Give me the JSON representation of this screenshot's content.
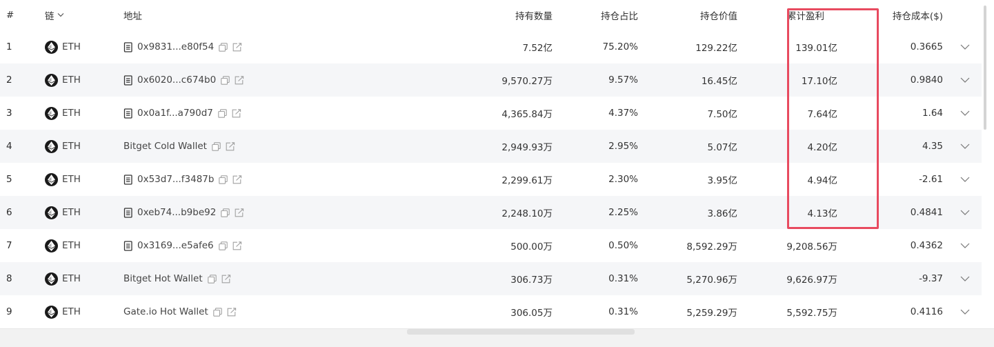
{
  "columns": {
    "index": "#",
    "chain": "链",
    "address": "地址",
    "holdings": "持有数量",
    "share": "持仓占比",
    "value": "持仓价值",
    "cumulative_pnl": "累计盈利",
    "cost_basis": "持仓成本($)"
  },
  "icons": {
    "chain_logo": "ethereum-icon",
    "contract": "document-icon",
    "copy": "copy-icon",
    "link": "external-link-icon",
    "expand": "chevron-down-icon"
  },
  "colors": {
    "highlight_border": "#e84a5f",
    "row_alt_bg": "#f5f6f8"
  },
  "rows": [
    {
      "index": "1",
      "chain": "ETH",
      "address": "0x9831...e80f54",
      "is_contract": true,
      "holdings": "7.52亿",
      "share": "75.20%",
      "value": "129.22亿",
      "pnl": "139.01亿",
      "cost": "0.3665"
    },
    {
      "index": "2",
      "chain": "ETH",
      "address": "0x6020...c674b0",
      "is_contract": true,
      "holdings": "9,570.27万",
      "share": "9.57%",
      "value": "16.45亿",
      "pnl": "17.10亿",
      "cost": "0.9840"
    },
    {
      "index": "3",
      "chain": "ETH",
      "address": "0x0a1f...a790d7",
      "is_contract": true,
      "holdings": "4,365.84万",
      "share": "4.37%",
      "value": "7.50亿",
      "pnl": "7.64亿",
      "cost": "1.64"
    },
    {
      "index": "4",
      "chain": "ETH",
      "address": "Bitget Cold Wallet",
      "is_contract": false,
      "holdings": "2,949.93万",
      "share": "2.95%",
      "value": "5.07亿",
      "pnl": "4.20亿",
      "cost": "4.35"
    },
    {
      "index": "5",
      "chain": "ETH",
      "address": "0x53d7...f3487b",
      "is_contract": true,
      "holdings": "2,299.61万",
      "share": "2.30%",
      "value": "3.95亿",
      "pnl": "4.94亿",
      "cost": "-2.61"
    },
    {
      "index": "6",
      "chain": "ETH",
      "address": "0xeb74...b9be92",
      "is_contract": true,
      "holdings": "2,248.10万",
      "share": "2.25%",
      "value": "3.86亿",
      "pnl": "4.13亿",
      "cost": "0.4841"
    },
    {
      "index": "7",
      "chain": "ETH",
      "address": "0x3169...e5afe6",
      "is_contract": true,
      "holdings": "500.00万",
      "share": "0.50%",
      "value": "8,592.29万",
      "pnl": "9,208.56万",
      "cost": "0.4362"
    },
    {
      "index": "8",
      "chain": "ETH",
      "address": "Bitget Hot Wallet",
      "is_contract": false,
      "holdings": "306.73万",
      "share": "0.31%",
      "value": "5,270.96万",
      "pnl": "9,626.97万",
      "cost": "-9.37"
    },
    {
      "index": "9",
      "chain": "ETH",
      "address": "Gate.io Hot Wallet",
      "is_contract": false,
      "holdings": "306.05万",
      "share": "0.31%",
      "value": "5,259.29万",
      "pnl": "5,592.75万",
      "cost": "0.4116"
    }
  ]
}
